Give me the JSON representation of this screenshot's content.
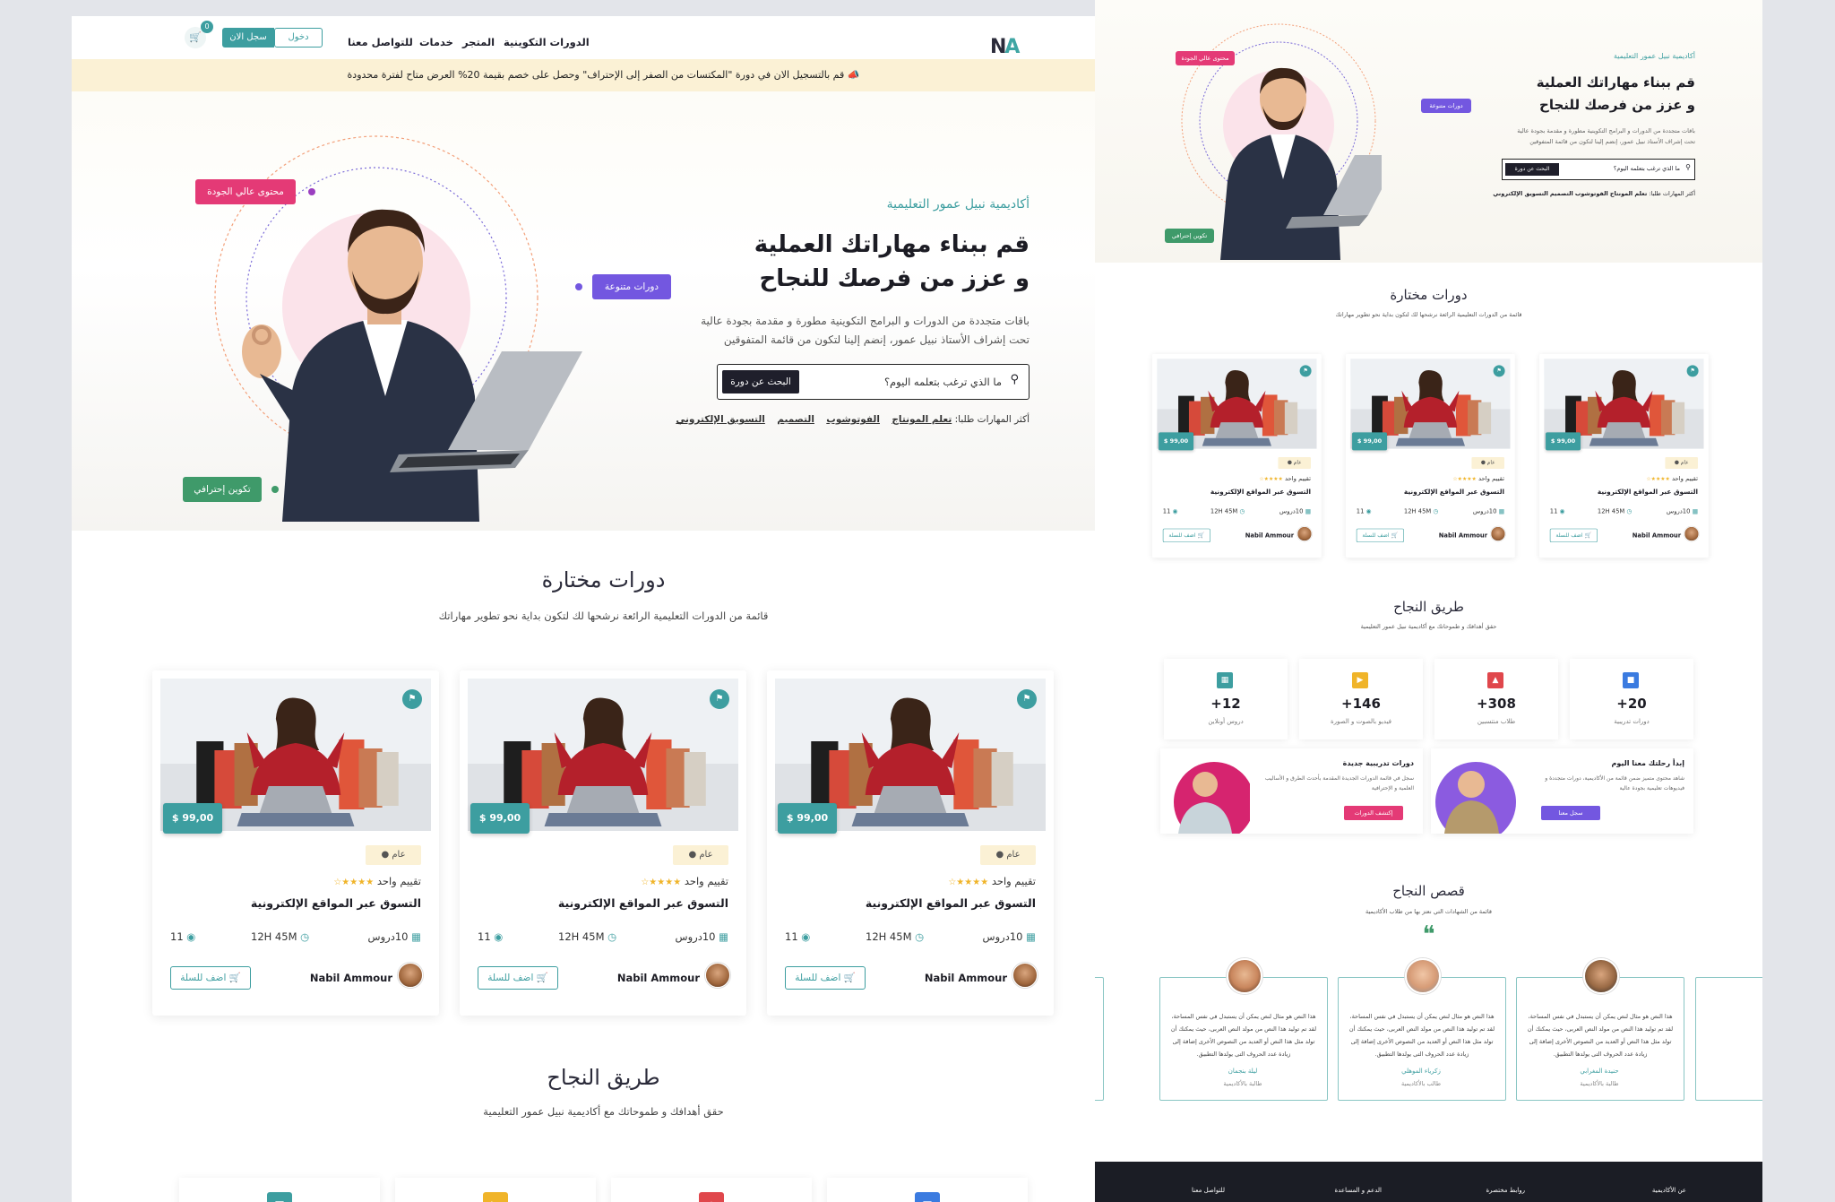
{
  "brand": {
    "logo_text": "NA",
    "accent": "#3d9ea0"
  },
  "nav": {
    "links": [
      "الدورات التكوينية",
      "المتجر",
      "خدمات",
      "للتواصل معنا"
    ],
    "login_label": "دخول",
    "register_label": "سجل الان",
    "cart_count": "0"
  },
  "announcement": "قم بالتسجيل الان في دورة \"المكتسات من الصفر إلى الإحتراف\" وحصل على خصم بقيمة 20% العرض متاح لفترة محدودة",
  "hero": {
    "tag": "أكاديمية نبيل عمور التعليمية",
    "title_line1": "قم ببناء مهاراتك العملية",
    "title_line2": "و عزز من فرصك للنجاح",
    "desc_line1": "باقات متجددة من الدورات و البرامج التكوينية مطورة و مقدمة بجودة عالية",
    "desc_line2": "تحت إشراف الأستاذ نبيل عمور، إنضم إلينا لتكون من قائمة المتفوقين",
    "search_placeholder": "ما الذي ترغب بتعلمه اليوم؟",
    "search_button": "البحث عن دورة",
    "skills_label": "أكثر المهارات طلبا:",
    "skills": [
      "تعلم المونتاج",
      "الفوتوشوب",
      "التصميم",
      "التسويق الإلكتروني"
    ],
    "badges": {
      "quality": "محتوى عالي الجودة",
      "variety": "دورات متنوعة",
      "pro": "تكوين إحترافي"
    }
  },
  "featured": {
    "title": "دورات مختارة",
    "subtitle": "قائمة من الدورات التعليمية الرائعة نرشحها لك لتكون بداية نحو تطوير مهاراتك",
    "courses": [
      {
        "price": "$ 99,00",
        "category": "عام",
        "rating": "تقييم واحد",
        "title": "التسوق عبر المواقع الإلكترونية",
        "lessons": "10دروس",
        "duration": "12H 45M",
        "students": "11",
        "author": "Nabil Ammour",
        "cart_label": "اضف للسلة"
      },
      {
        "price": "$ 99,00",
        "category": "عام",
        "rating": "تقييم واحد",
        "title": "التسوق عبر المواقع الإلكترونية",
        "lessons": "10دروس",
        "duration": "12H 45M",
        "students": "11",
        "author": "Nabil Ammour",
        "cart_label": "اضف للسلة"
      },
      {
        "price": "$ 99,00",
        "category": "عام",
        "rating": "تقييم واحد",
        "title": "التسوق عبر المواقع الإلكترونية",
        "lessons": "10دروس",
        "duration": "12H 45M",
        "students": "11",
        "author": "Nabil Ammour",
        "cart_label": "اضف للسلة"
      }
    ]
  },
  "success_path": {
    "title": "طريق النجاح",
    "subtitle": "حقق أهدافك و طموحاتك مع أكاديمية نبيل عمور التعليمية",
    "stats": [
      {
        "value": "+20",
        "label": "دورات تدريبية",
        "color": "#3b7be0"
      },
      {
        "value": "+308",
        "label": "طلاب منتسبين",
        "color": "#e0474c"
      },
      {
        "value": "+146",
        "label": "فيديو بالصوت و الصورة",
        "color": "#f0b429"
      },
      {
        "value": "+12",
        "label": "دروس أونلاين",
        "color": "#3d9ea0"
      }
    ],
    "promos": [
      {
        "title": "إبدأ رحلتك معنا اليوم",
        "text": "شاهد محتوى متميز ضمن قائمة من الأكاديمية، دورات متجددة و فيديوهات تعليمية بجودة عالية",
        "button": "سجل معنا"
      },
      {
        "title": "دورات تدريبية جديدة",
        "text": "سجل في قائمة الدورات الجديدة المقدمة بأحدث الطرق و الأساليب العلمية و الإحترافية",
        "button": "إكتشف الدورات"
      }
    ]
  },
  "stories": {
    "title": "قصص النجاح",
    "subtitle": "قائمة من الشهادات التي نعتز بها من طلاب الأكاديمية",
    "quote_mark": "❝",
    "items": [
      {
        "text": "هذا النص هو مثال لنص يمكن أن يستبدل في نفس المساحة، لقد تم توليد هذا النص من مولد النص العربى، حيث يمكنك أن تولد مثل هذا النص أو العديد من النصوص الأخرى إضافة إلى زيادة عدد الحروف التى يولدها التطبيق.",
        "name": "حنيدة المغرابي",
        "role": "طالبة بالأكاديمية"
      },
      {
        "text": "هذا النص هو مثال لنص يمكن أن يستبدل في نفس المساحة، لقد تم توليد هذا النص من مولد النص العربى، حيث يمكنك أن تولد مثل هذا النص أو العديد من النصوص الأخرى إضافة إلى زيادة عدد الحروف التى يولدها التطبيق.",
        "name": "زكرياء الموهلي",
        "role": "طالب بالأكاديمية"
      },
      {
        "text": "هذا النص هو مثال لنص يمكن أن يستبدل في نفس المساحة، لقد تم توليد هذا النص من مولد النص العربى، حيث يمكنك أن تولد مثل هذا النص أو العديد من النصوص الأخرى إضافة إلى زيادة عدد الحروف التى يولدها التطبيق.",
        "name": "ليلة بنجمان",
        "role": "طالبة بالأكاديمية"
      }
    ]
  },
  "footer": {
    "columns": [
      "عن الأكاديمية",
      "روابط مختصرة",
      "الدعم و المساعدة",
      "للتواصل معنا"
    ]
  }
}
